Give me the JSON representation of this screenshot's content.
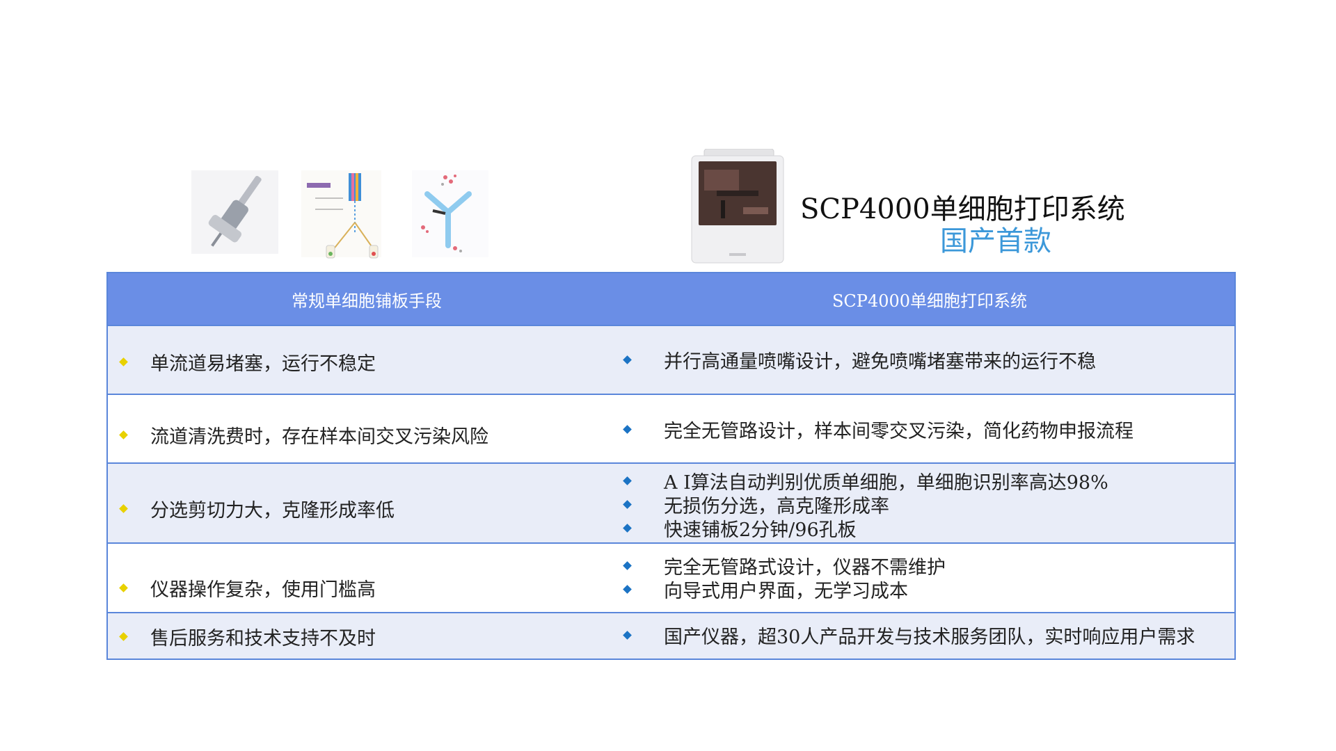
{
  "header": {
    "product_title": "SCP4000单细胞打印系统",
    "product_subtitle": "国产首款"
  },
  "illustrations": [
    {
      "icon": "pipette-icon"
    },
    {
      "icon": "flow-sorter-diagram-icon"
    },
    {
      "icon": "antibody-cells-icon"
    },
    {
      "icon": "scp4000-device-image"
    }
  ],
  "table": {
    "col_left": "常规单细胞铺板手段",
    "col_right": "SCP4000单细胞打印系统",
    "rows": [
      {
        "left": "单流道易堵塞，运行不稳定",
        "right": [
          "并行高通量喷嘴设计，避免喷嘴堵塞带来的运行不稳"
        ]
      },
      {
        "left": "流道清洗费时，存在样本间交叉污染风险",
        "right": [
          "完全无管路设计，样本间零交叉污染，简化药物申报流程"
        ]
      },
      {
        "left": "分选剪切力大，克隆形成率低",
        "right": [
          "A I算法自动判别优质单细胞，单细胞识别率高达98%",
          "无损伤分选，高克隆形成率",
          "快速铺板2分钟/96孔板"
        ]
      },
      {
        "left": "仪器操作复杂，使用门槛高",
        "right": [
          "完全无管路式设计，仪器不需维护",
          "向导式用户界面，无学习成本"
        ]
      },
      {
        "left": "售后服务和技术支持不及时",
        "right": [
          "国产仪器，超30人产品开发与技术服务团队，实时响应用户需求"
        ]
      }
    ]
  },
  "colors": {
    "header_bg": "#6a8ee6",
    "border": "#5a86da",
    "row_alt_bg": "#e9edf8",
    "subtitle": "#3c98d9",
    "bullet_left": "#e8d100",
    "bullet_right": "#1b73c4"
  }
}
